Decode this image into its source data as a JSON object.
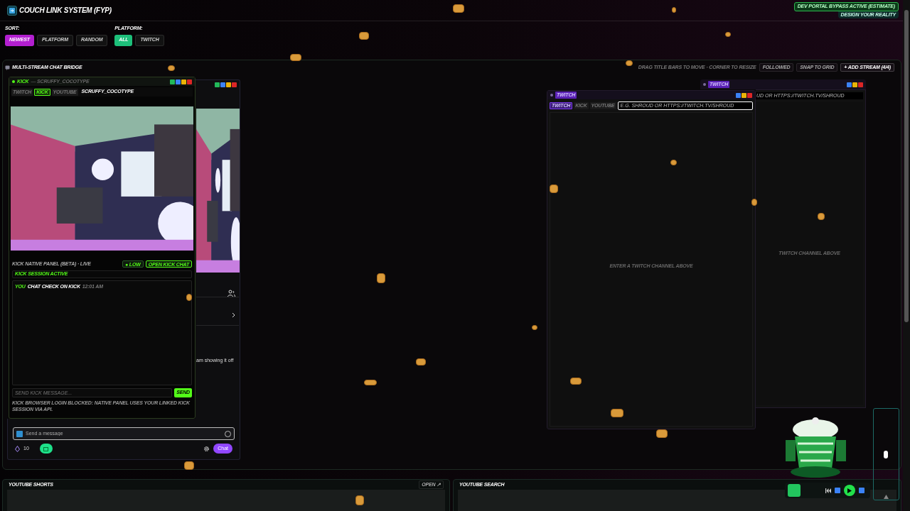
{
  "header": {
    "title": "COUCH LINK SYSTEM (FYP)",
    "badge": "DEV PORTAL BYPASS ACTIVE (ESTIMATE)",
    "tagline": "DESIGN YOUR REALITY"
  },
  "filters": [
    {
      "label": "SORT:",
      "options": [
        {
          "label": "NEWEST",
          "selected": true
        },
        {
          "label": "PLATFORM",
          "selected": false
        },
        {
          "label": "RANDOM",
          "selected": false
        }
      ]
    },
    {
      "label": "PLATFORM:",
      "options": [
        {
          "label": "ALL",
          "selected": true
        },
        {
          "label": "TWITCH",
          "selected": false
        }
      ]
    }
  ],
  "bridge": {
    "title": "MULTI-STREAM CHAT BRIDGE",
    "hint": "DRAG TITLE BARS TO MOVE · CORNER TO RESIZE",
    "buttons": [
      {
        "label": "FOLLOWED",
        "kind": "followed"
      },
      {
        "label": "SNAP TO GRID",
        "kind": "grid"
      },
      {
        "label": "+ ADD STREAM (4/4)",
        "kind": "add"
      }
    ]
  },
  "embed": {
    "fragment": "am showing it off",
    "placeholder": "Send a message",
    "points": "10",
    "chat_button": "Chat"
  },
  "kick_window": {
    "platform": "KICK",
    "channel_note": "— SCRUFFY_COCOTYPE",
    "tabs": [
      {
        "label": "TWITCH",
        "selected": false
      },
      {
        "label": "KICK",
        "selected": true
      },
      {
        "label": "YOUTUBE",
        "selected": false
      }
    ],
    "channel": "SCRUFFY_COCOTYPE",
    "panel_title": "KICK NATIVE PANEL (BETA) · LIVE",
    "low_button": "● LOW",
    "open_button": "OPEN KICK CHAT",
    "session": "KICK SESSION ACTIVE",
    "messages": [
      {
        "user": "YOU",
        "text": "CHAT CHECK ON KICK",
        "time": "12:01 AM"
      }
    ],
    "placeholder": "SEND KICK MESSAGE...",
    "send": "SEND",
    "note": "KICK BROWSER LOGIN BLOCKED: NATIVE PANEL USES YOUR LINKED KICK SESSION VIA API."
  },
  "twitch_windows": [
    {
      "platform": "TWITCH",
      "tabs": [
        {
          "label": "TWITCH",
          "selected": true
        },
        {
          "label": "KICK",
          "selected": false
        },
        {
          "label": "YOUTUBE",
          "selected": false
        }
      ],
      "placeholder": "E.G. SHROUD OR HTTPS://TWITCH.TV/SHROUD",
      "empty": "ENTER A TWITCH CHANNEL ABOVE"
    },
    {
      "platform": "TWITCH",
      "placeholder": "UD OR HTTPS://TWITCH.TV/SHROUD",
      "empty": "TWITCH CHANNEL ABOVE"
    }
  ],
  "bottom_panels": [
    {
      "title": "YOUTUBE SHORTS",
      "action": "OPEN ↗"
    },
    {
      "title": "YOUTUBE SEARCH"
    }
  ],
  "player": {
    "volume": {
      "level": 0.5
    }
  }
}
